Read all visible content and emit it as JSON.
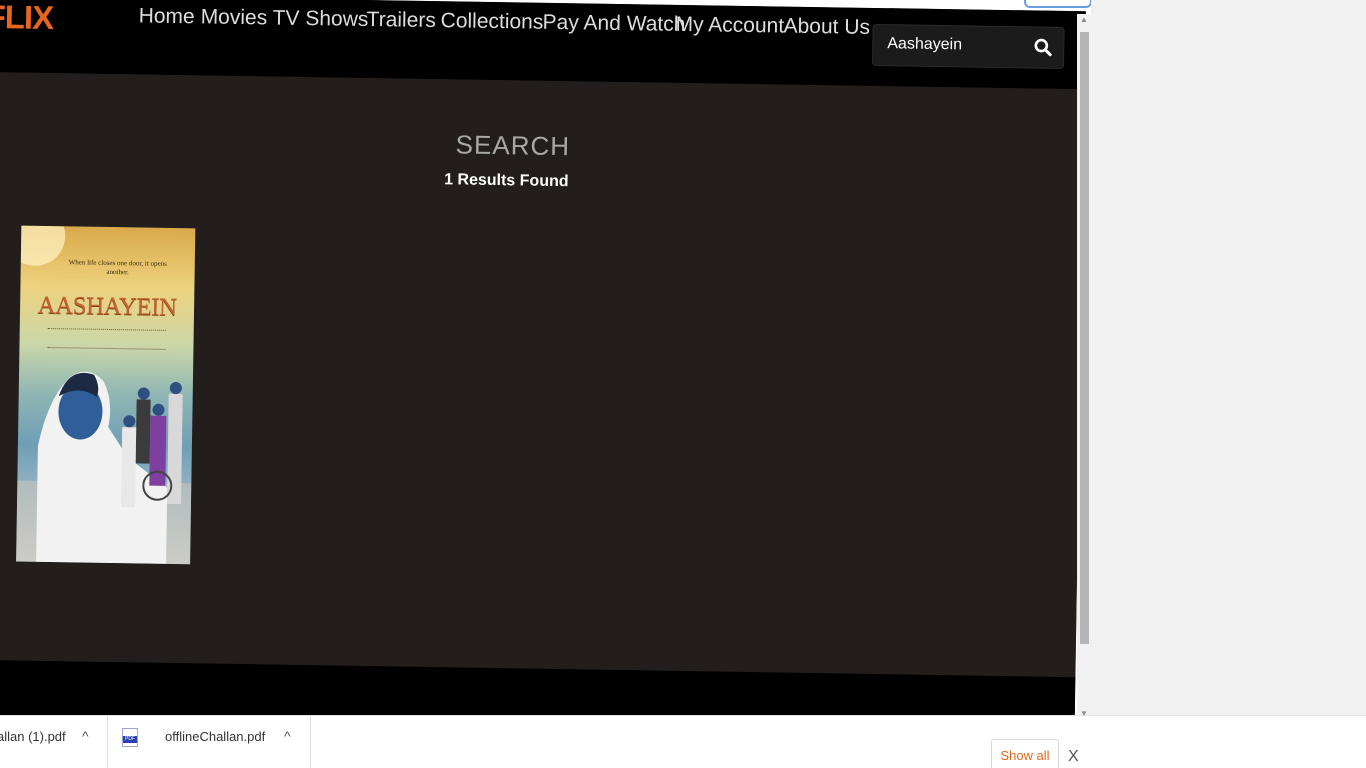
{
  "site": {
    "logo": "FLIX",
    "nav": [
      "Home",
      "Movies",
      "TV Shows",
      "Trailers",
      "Collections",
      "Pay And Watch",
      "My Account",
      "About Us"
    ],
    "search": {
      "value": "Aashayein"
    }
  },
  "content": {
    "title": "SEARCH",
    "results_text": "1 Results Found",
    "results": [
      {
        "poster_tagline": "When life closes one door, it opens another.",
        "poster_title": "AASHAYEIN"
      }
    ]
  },
  "downloads": {
    "items": [
      {
        "name": "allan (1).pdf"
      },
      {
        "name": "offlineChallan.pdf",
        "icon_text": "PDF"
      }
    ],
    "show_all_label": "Show all",
    "close_label": "X",
    "chevron": "^"
  },
  "colors": {
    "accent": "#e8651f",
    "page_bg": "#231d1b",
    "nav_bg": "#000000",
    "show_all_text": "#e26a1a"
  }
}
